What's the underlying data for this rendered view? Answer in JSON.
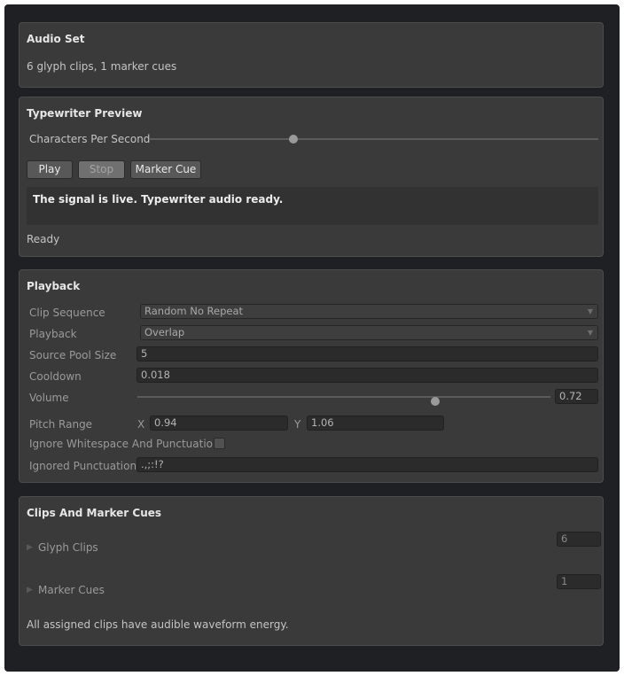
{
  "audio_set": {
    "title": "Audio Set",
    "summary": "6 glyph clips, 1 marker cues"
  },
  "typewriter_preview": {
    "title": "Typewriter Preview",
    "cps_label": "Characters Per Second",
    "cps_fraction": 0.32,
    "buttons": {
      "play": "Play",
      "stop": "Stop",
      "marker_cue": "Marker Cue"
    },
    "preview_text": "The signal is live. Typewriter audio ready.",
    "status": "Ready"
  },
  "playback": {
    "title": "Playback",
    "clip_sequence": {
      "label": "Clip Sequence",
      "value": "Random No Repeat"
    },
    "playback_mode": {
      "label": "Playback",
      "value": "Overlap"
    },
    "source_pool_size": {
      "label": "Source Pool Size",
      "value": "5"
    },
    "cooldown": {
      "label": "Cooldown",
      "value": "0.018"
    },
    "volume": {
      "label": "Volume",
      "value": "0.72",
      "fraction": 0.72
    },
    "pitch_range": {
      "label": "Pitch Range",
      "x_label": "X",
      "x_value": "0.94",
      "y_label": "Y",
      "y_value": "1.06"
    },
    "ignore_whitespace": {
      "label": "Ignore Whitespace And Punctuation",
      "checked": false
    },
    "ignored_punctuation": {
      "label": "Ignored Punctuation",
      "value": ".,;:!?"
    }
  },
  "clips": {
    "title": "Clips And Marker Cues",
    "glyph_clips": {
      "label": "Glyph Clips",
      "count": "6"
    },
    "marker_cues": {
      "label": "Marker Cues",
      "count": "1"
    },
    "status": "All assigned clips have audible waveform energy."
  }
}
